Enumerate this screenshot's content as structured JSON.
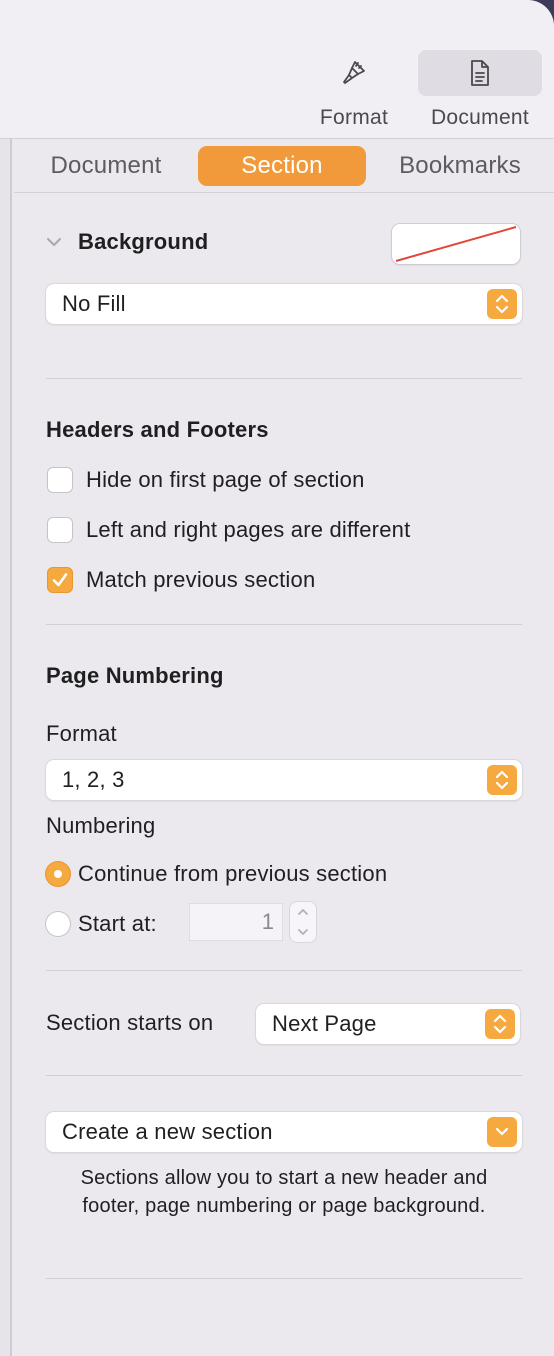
{
  "toolbar": {
    "format_label": "Format",
    "document_label": "Document"
  },
  "tabs": [
    {
      "label": "Document"
    },
    {
      "label": "Section"
    },
    {
      "label": "Bookmarks"
    }
  ],
  "background": {
    "title": "Background",
    "fill_value": "No Fill"
  },
  "headers_footers": {
    "title": "Headers and Footers",
    "options": [
      {
        "label": "Hide on first page of section",
        "checked": false
      },
      {
        "label": "Left and right pages are different",
        "checked": false
      },
      {
        "label": "Match previous section",
        "checked": true
      }
    ]
  },
  "page_numbering": {
    "title": "Page Numbering",
    "format_label": "Format",
    "format_value": "1, 2, 3",
    "numbering_label": "Numbering",
    "continue_label": "Continue from previous section",
    "start_at_label": "Start at:",
    "start_at_value": "1"
  },
  "section_starts": {
    "label": "Section starts on",
    "value": "Next Page"
  },
  "create_section": {
    "value": "Create a new section",
    "info": "Sections allow you to start a new header and footer, page numbering or page background."
  },
  "colors": {
    "accent": "#f09a3b",
    "checkbox_accent": "#f5a93e",
    "panel_bg": "#ebe8ee"
  }
}
